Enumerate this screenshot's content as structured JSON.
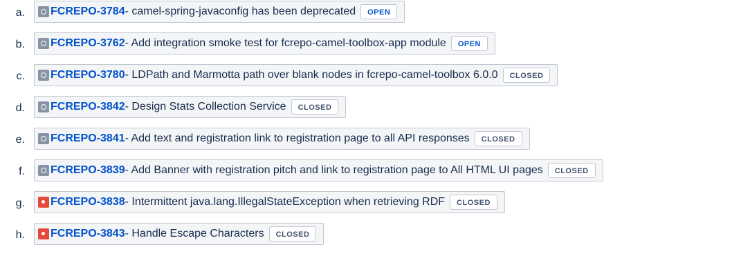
{
  "issues": [
    {
      "marker": "a.",
      "key": "FCREPO-3784",
      "summary": " - camel-spring-javaconfig has been deprecated",
      "status": "OPEN",
      "status_class": "open",
      "icon": "gray"
    },
    {
      "marker": "b.",
      "key": "FCREPO-3762",
      "summary": " - Add integration smoke test for fcrepo-camel-toolbox-app module",
      "status": "OPEN",
      "status_class": "open",
      "icon": "gray"
    },
    {
      "marker": "c.",
      "key": "FCREPO-3780",
      "summary": " - LDPath and Marmotta path over blank nodes in fcrepo-camel-toolbox 6.0.0",
      "status": "CLOSED",
      "status_class": "closed",
      "icon": "gray"
    },
    {
      "marker": "d.",
      "key": "FCREPO-3842",
      "summary": " - Design Stats Collection Service",
      "status": "CLOSED",
      "status_class": "closed",
      "icon": "gray"
    },
    {
      "marker": "e.",
      "key": "FCREPO-3841",
      "summary": " - Add text and registration link to registration page to all API responses",
      "status": "CLOSED",
      "status_class": "closed",
      "icon": "gray"
    },
    {
      "marker": "f.",
      "key": "FCREPO-3839",
      "summary": " - Add Banner with registration pitch and link to registration page to All HTML UI pages",
      "status": "CLOSED",
      "status_class": "closed",
      "icon": "gray"
    },
    {
      "marker": "g.",
      "key": "FCREPO-3838",
      "summary": " - Intermittent java.lang.IllegalStateException when retrieving RDF",
      "status": "CLOSED",
      "status_class": "closed",
      "icon": "red"
    },
    {
      "marker": "h.",
      "key": "FCREPO-3843",
      "summary": " - Handle Escape Characters",
      "status": "CLOSED",
      "status_class": "closed",
      "icon": "red"
    }
  ]
}
